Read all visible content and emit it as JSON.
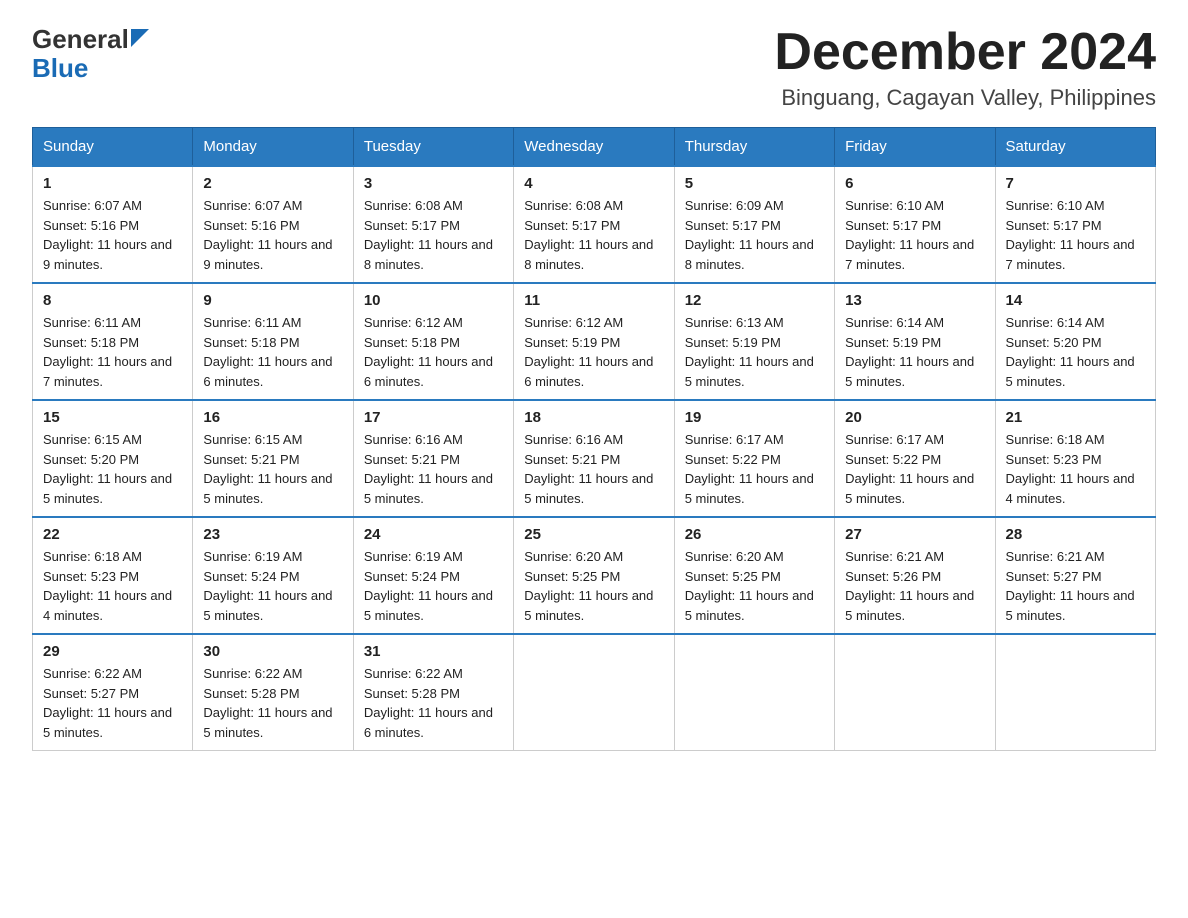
{
  "header": {
    "logo_general": "General",
    "logo_blue": "Blue",
    "month_title": "December 2024",
    "location": "Binguang, Cagayan Valley, Philippines"
  },
  "weekdays": [
    "Sunday",
    "Monday",
    "Tuesday",
    "Wednesday",
    "Thursday",
    "Friday",
    "Saturday"
  ],
  "weeks": [
    [
      {
        "day": "1",
        "sunrise": "6:07 AM",
        "sunset": "5:16 PM",
        "daylight": "11 hours and 9 minutes."
      },
      {
        "day": "2",
        "sunrise": "6:07 AM",
        "sunset": "5:16 PM",
        "daylight": "11 hours and 9 minutes."
      },
      {
        "day": "3",
        "sunrise": "6:08 AM",
        "sunset": "5:17 PM",
        "daylight": "11 hours and 8 minutes."
      },
      {
        "day": "4",
        "sunrise": "6:08 AM",
        "sunset": "5:17 PM",
        "daylight": "11 hours and 8 minutes."
      },
      {
        "day": "5",
        "sunrise": "6:09 AM",
        "sunset": "5:17 PM",
        "daylight": "11 hours and 8 minutes."
      },
      {
        "day": "6",
        "sunrise": "6:10 AM",
        "sunset": "5:17 PM",
        "daylight": "11 hours and 7 minutes."
      },
      {
        "day": "7",
        "sunrise": "6:10 AM",
        "sunset": "5:17 PM",
        "daylight": "11 hours and 7 minutes."
      }
    ],
    [
      {
        "day": "8",
        "sunrise": "6:11 AM",
        "sunset": "5:18 PM",
        "daylight": "11 hours and 7 minutes."
      },
      {
        "day": "9",
        "sunrise": "6:11 AM",
        "sunset": "5:18 PM",
        "daylight": "11 hours and 6 minutes."
      },
      {
        "day": "10",
        "sunrise": "6:12 AM",
        "sunset": "5:18 PM",
        "daylight": "11 hours and 6 minutes."
      },
      {
        "day": "11",
        "sunrise": "6:12 AM",
        "sunset": "5:19 PM",
        "daylight": "11 hours and 6 minutes."
      },
      {
        "day": "12",
        "sunrise": "6:13 AM",
        "sunset": "5:19 PM",
        "daylight": "11 hours and 5 minutes."
      },
      {
        "day": "13",
        "sunrise": "6:14 AM",
        "sunset": "5:19 PM",
        "daylight": "11 hours and 5 minutes."
      },
      {
        "day": "14",
        "sunrise": "6:14 AM",
        "sunset": "5:20 PM",
        "daylight": "11 hours and 5 minutes."
      }
    ],
    [
      {
        "day": "15",
        "sunrise": "6:15 AM",
        "sunset": "5:20 PM",
        "daylight": "11 hours and 5 minutes."
      },
      {
        "day": "16",
        "sunrise": "6:15 AM",
        "sunset": "5:21 PM",
        "daylight": "11 hours and 5 minutes."
      },
      {
        "day": "17",
        "sunrise": "6:16 AM",
        "sunset": "5:21 PM",
        "daylight": "11 hours and 5 minutes."
      },
      {
        "day": "18",
        "sunrise": "6:16 AM",
        "sunset": "5:21 PM",
        "daylight": "11 hours and 5 minutes."
      },
      {
        "day": "19",
        "sunrise": "6:17 AM",
        "sunset": "5:22 PM",
        "daylight": "11 hours and 5 minutes."
      },
      {
        "day": "20",
        "sunrise": "6:17 AM",
        "sunset": "5:22 PM",
        "daylight": "11 hours and 5 minutes."
      },
      {
        "day": "21",
        "sunrise": "6:18 AM",
        "sunset": "5:23 PM",
        "daylight": "11 hours and 4 minutes."
      }
    ],
    [
      {
        "day": "22",
        "sunrise": "6:18 AM",
        "sunset": "5:23 PM",
        "daylight": "11 hours and 4 minutes."
      },
      {
        "day": "23",
        "sunrise": "6:19 AM",
        "sunset": "5:24 PM",
        "daylight": "11 hours and 5 minutes."
      },
      {
        "day": "24",
        "sunrise": "6:19 AM",
        "sunset": "5:24 PM",
        "daylight": "11 hours and 5 minutes."
      },
      {
        "day": "25",
        "sunrise": "6:20 AM",
        "sunset": "5:25 PM",
        "daylight": "11 hours and 5 minutes."
      },
      {
        "day": "26",
        "sunrise": "6:20 AM",
        "sunset": "5:25 PM",
        "daylight": "11 hours and 5 minutes."
      },
      {
        "day": "27",
        "sunrise": "6:21 AM",
        "sunset": "5:26 PM",
        "daylight": "11 hours and 5 minutes."
      },
      {
        "day": "28",
        "sunrise": "6:21 AM",
        "sunset": "5:27 PM",
        "daylight": "11 hours and 5 minutes."
      }
    ],
    [
      {
        "day": "29",
        "sunrise": "6:22 AM",
        "sunset": "5:27 PM",
        "daylight": "11 hours and 5 minutes."
      },
      {
        "day": "30",
        "sunrise": "6:22 AM",
        "sunset": "5:28 PM",
        "daylight": "11 hours and 5 minutes."
      },
      {
        "day": "31",
        "sunrise": "6:22 AM",
        "sunset": "5:28 PM",
        "daylight": "11 hours and 6 minutes."
      },
      null,
      null,
      null,
      null
    ]
  ]
}
